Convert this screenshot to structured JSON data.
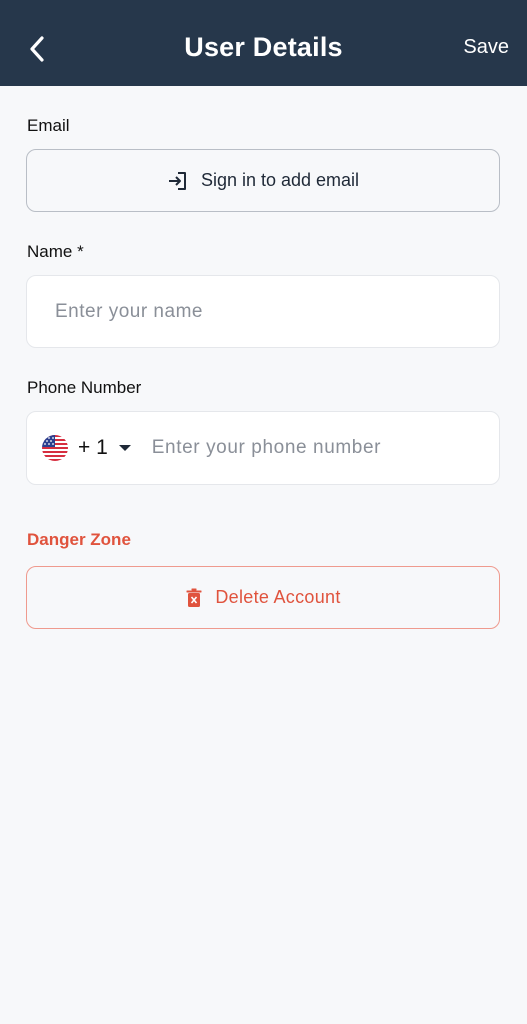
{
  "header": {
    "title": "User Details",
    "save_label": "Save",
    "background": "#26374b"
  },
  "email": {
    "label": "Email",
    "button_label": "Sign in to add email",
    "icon": "sign-in-icon"
  },
  "name": {
    "label": "Name *",
    "value": "",
    "placeholder": "Enter your name"
  },
  "phone": {
    "label": "Phone Number",
    "country_flag": "us-flag-icon",
    "dial_code": "+ 1",
    "value": "",
    "placeholder": "Enter your phone number"
  },
  "danger": {
    "label": "Danger Zone",
    "delete_label": "Delete Account",
    "icon": "trash-icon",
    "color": "#e0533d"
  }
}
